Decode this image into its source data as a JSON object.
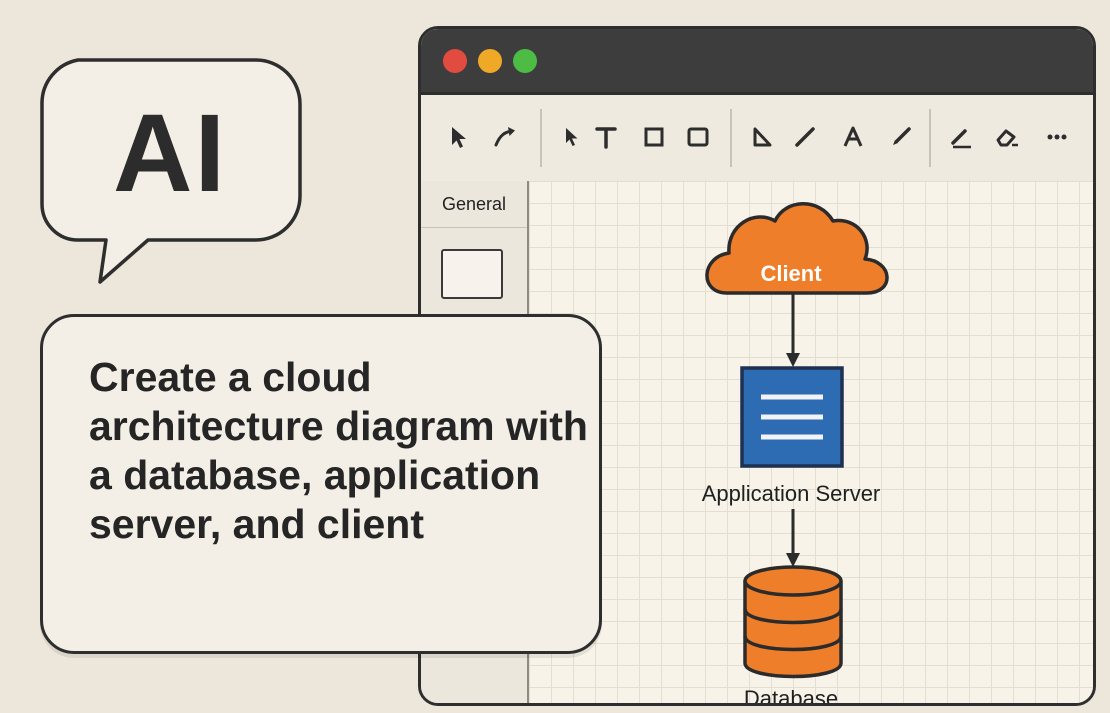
{
  "ai_badge": {
    "label": "AI"
  },
  "prompt": {
    "text": "Create a cloud architecture diagram with a database, application server, and client"
  },
  "window": {
    "controls": {
      "close_color": "#e24b40",
      "minimize_color": "#f0a926",
      "maximize_color": "#4cbc45"
    },
    "toolbar": {
      "tools": [
        "select-arrow-icon",
        "connector-icon",
        "pointer-icon",
        "text-tool-icon",
        "rectangle-icon",
        "square-icon",
        "triangle-icon",
        "line-icon",
        "text-a-icon",
        "pen-icon",
        "pencil-icon",
        "eraser-icon",
        "more-icon"
      ]
    },
    "sidebar": {
      "header": "General"
    }
  },
  "diagram": {
    "nodes": [
      {
        "id": "client",
        "label": "Client",
        "shape": "cloud",
        "color": "#ee7e2a"
      },
      {
        "id": "app_server",
        "label": "Application Server",
        "shape": "server",
        "color": "#2d6bb3"
      },
      {
        "id": "database",
        "label": "Database",
        "shape": "cylinder",
        "color": "#ee7e2a"
      }
    ],
    "edges": [
      {
        "from": "client",
        "to": "app_server"
      },
      {
        "from": "app_server",
        "to": "database"
      }
    ]
  }
}
